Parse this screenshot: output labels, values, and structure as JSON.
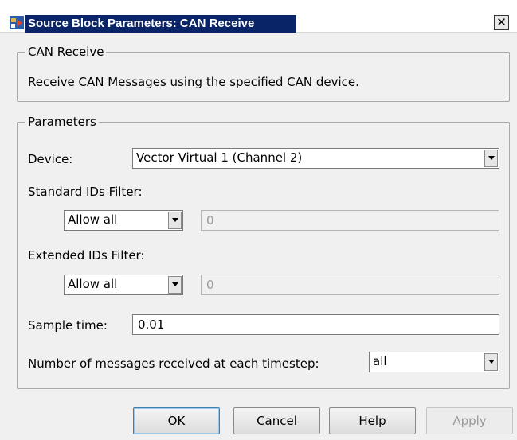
{
  "window": {
    "title": "Source Block Parameters: CAN Receive",
    "close_label": "x"
  },
  "description_group": {
    "legend": "CAN Receive",
    "text": "Receive CAN Messages using the specified CAN device."
  },
  "parameters_group": {
    "legend": "Parameters",
    "device": {
      "label": "Device:",
      "value": "Vector Virtual 1 (Channel 2)"
    },
    "standard_ids": {
      "label": "Standard IDs Filter:",
      "select_value": "Allow all",
      "ids_value": "0"
    },
    "extended_ids": {
      "label": "Extended IDs Filter:",
      "select_value": "Allow all",
      "ids_value": "0"
    },
    "sample_time": {
      "label": "Sample time:",
      "value": "0.01"
    },
    "messages": {
      "label": "Number of messages received at each timestep:",
      "value": "all"
    }
  },
  "buttons": {
    "ok": "OK",
    "cancel": "Cancel",
    "help": "Help",
    "apply": "Apply"
  }
}
